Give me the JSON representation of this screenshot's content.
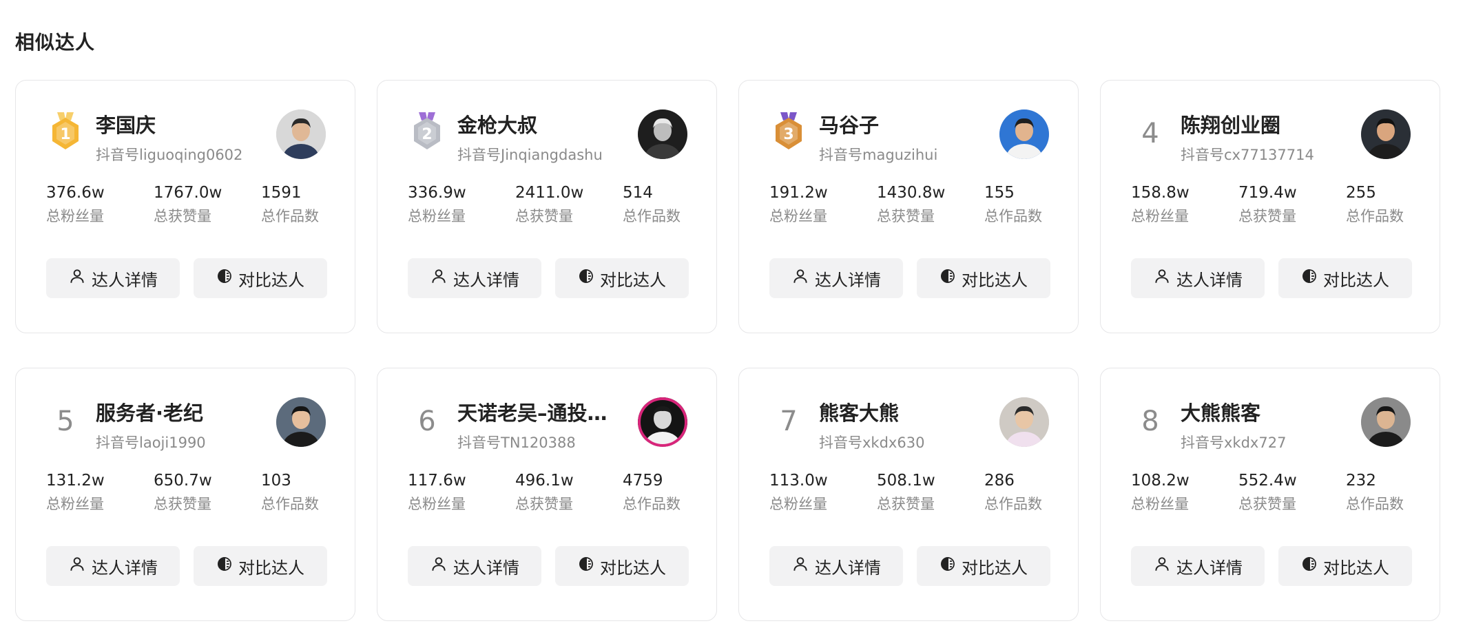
{
  "section": {
    "title": "相似达人"
  },
  "labels": {
    "fans": "总粉丝量",
    "likes": "总获赞量",
    "works": "总作品数",
    "detail_button": "达人详情",
    "compare_button": "对比达人"
  },
  "colors": {
    "gold": "#f5b635",
    "silver": "#b9bcc4",
    "bronze": "#d98f37",
    "button_bg": "#f2f2f3"
  },
  "creators": [
    {
      "rank": "1",
      "medal": "gold",
      "name": "李国庆",
      "handle": "抖音号liguoqing0602",
      "fans": "376.6w",
      "likes": "1767.0w",
      "works": "1591",
      "avatar": {
        "bg": "#d8d8d8",
        "skin": "#e0b896",
        "shirt": "#2e3d5c",
        "hair": "#2a2a2a"
      }
    },
    {
      "rank": "2",
      "medal": "silver",
      "name": "金枪大叔",
      "handle": "抖音号Jinqiangdashu",
      "fans": "336.9w",
      "likes": "2411.0w",
      "works": "514",
      "avatar": {
        "bg": "#1e1e1e",
        "skin": "#bdbdbd",
        "shirt": "#3a3a3a",
        "hair": "#e8e8e8"
      }
    },
    {
      "rank": "3",
      "medal": "bronze",
      "name": "马谷子",
      "handle": "抖音号maguzihui",
      "fans": "191.2w",
      "likes": "1430.8w",
      "works": "155",
      "avatar": {
        "bg": "#2f76d4",
        "skin": "#e2b48e",
        "shirt": "#f3f3f3",
        "hair": "#1f1f1f"
      }
    },
    {
      "rank": "4",
      "medal": "",
      "name": "陈翔创业圈",
      "handle": "抖音号cx77137714",
      "fans": "158.8w",
      "likes": "719.4w",
      "works": "255",
      "avatar": {
        "bg": "#2a2f36",
        "skin": "#d9a57e",
        "shirt": "#1d1d1d",
        "hair": "#111111"
      }
    },
    {
      "rank": "5",
      "medal": "",
      "name": "服务者·老纪",
      "handle": "抖音号laoji1990",
      "fans": "131.2w",
      "likes": "650.7w",
      "works": "103",
      "avatar": {
        "bg": "#5c6b7c",
        "skin": "#e6bf9d",
        "shirt": "#1b1b1b",
        "hair": "#151515"
      }
    },
    {
      "rank": "6",
      "medal": "",
      "name": "天诺老吴–通投…",
      "handle": "抖音号TN120388",
      "fans": "117.6w",
      "likes": "496.1w",
      "works": "4759",
      "avatar": {
        "bg": "#141414",
        "skin": "#d8d8d8",
        "shirt": "#f2f2f2",
        "hair": "#1a1a1a",
        "ring": "#d8257a"
      }
    },
    {
      "rank": "7",
      "medal": "",
      "name": "熊客大熊",
      "handle": "抖音号xkdx630",
      "fans": "113.0w",
      "likes": "508.1w",
      "works": "286",
      "avatar": {
        "bg": "#cfcac4",
        "skin": "#e8c6a6",
        "shirt": "#f0e0ee",
        "hair": "#2b2b2b"
      }
    },
    {
      "rank": "8",
      "medal": "",
      "name": "大熊熊客",
      "handle": "抖音号xkdx727",
      "fans": "108.2w",
      "likes": "552.4w",
      "works": "232",
      "avatar": {
        "bg": "#8a8a8a",
        "skin": "#dcb592",
        "shirt": "#1c1c1c",
        "hair": "#161616"
      }
    }
  ]
}
